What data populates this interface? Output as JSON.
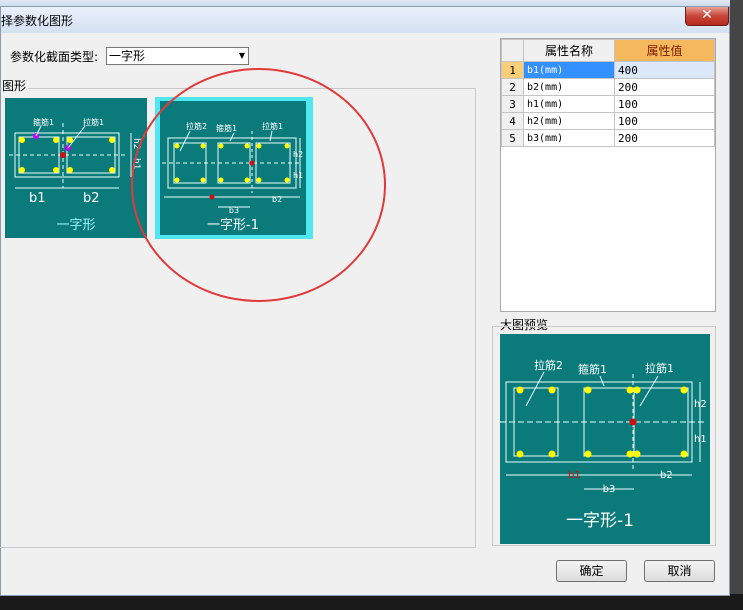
{
  "dialog": {
    "title": "择参数化图形",
    "close_glyph": "✕"
  },
  "form": {
    "section_type_label": "参数化截面类型:",
    "section_type_value": "一字形"
  },
  "shapes_group": {
    "label": "图形",
    "items": [
      {
        "name": "一字形",
        "annotations": [
          "箍筋1",
          "拉筋1",
          "b1",
          "b2",
          "h2",
          "h1"
        ],
        "selected": false
      },
      {
        "name": "一字形-1",
        "annotations": [
          "拉筋2",
          "箍筋1",
          "拉筋1",
          "h2",
          "h1",
          "b3",
          "b2"
        ],
        "selected": true
      }
    ]
  },
  "properties_grid": {
    "headers": [
      "属性名称",
      "属性值"
    ],
    "rows": [
      {
        "index": "1",
        "name": "b1(mm)",
        "value": "400"
      },
      {
        "index": "2",
        "name": "b2(mm)",
        "value": "200"
      },
      {
        "index": "3",
        "name": "h1(mm)",
        "value": "100"
      },
      {
        "index": "4",
        "name": "h2(mm)",
        "value": "100"
      },
      {
        "index": "5",
        "name": "b3(mm)",
        "value": "200"
      }
    ],
    "selected_row": 1
  },
  "preview": {
    "label": "大图预览",
    "caption": "一字形-1",
    "annotations": {
      "tie2": "拉筋2",
      "stirrup1": "箍筋1",
      "tie1": "拉筋1",
      "h2": "h2",
      "h1": "h1",
      "b1": "b1",
      "b3": "b3",
      "b2": "b2"
    }
  },
  "buttons": {
    "ok": "确定",
    "cancel": "取消"
  },
  "colors": {
    "thumbnail_bg": "#0b7a7a",
    "selection_border": "#52e6f2",
    "header_value_bg": "#f5b85c",
    "selected_cell": "#3390ff",
    "annotation_circle": "#e03a3a"
  }
}
